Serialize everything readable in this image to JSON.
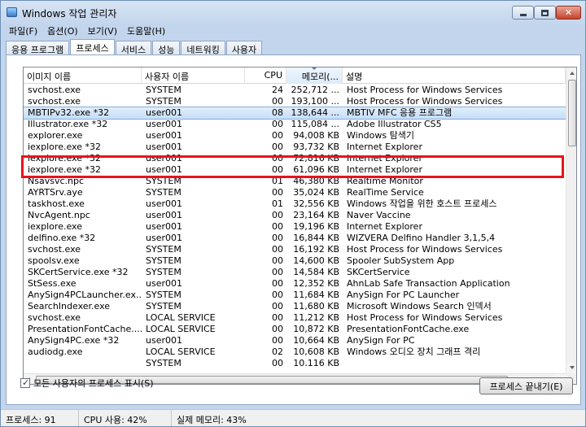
{
  "window": {
    "title": "Windows 작업 관리자"
  },
  "colors": {
    "selection_outline": "#e8141c",
    "titlebar": "#c9d9ee"
  },
  "menu": [
    "파일(F)",
    "옵션(O)",
    "보기(V)",
    "도움말(H)"
  ],
  "tabs": [
    {
      "label": "응용 프로그램",
      "active": false
    },
    {
      "label": "프로세스",
      "active": true
    },
    {
      "label": "서비스",
      "active": false
    },
    {
      "label": "성능",
      "active": false
    },
    {
      "label": "네트워킹",
      "active": false
    },
    {
      "label": "사용자",
      "active": false
    }
  ],
  "columns": {
    "name": "이미지 이름",
    "user": "사용자 이름",
    "cpu": "CPU",
    "mem": "메모리(...",
    "desc": "설명"
  },
  "rows": [
    [
      "svchost.exe",
      "SYSTEM",
      "24",
      "252,712 ...",
      "Host Process for Windows Services"
    ],
    [
      "svchost.exe",
      "SYSTEM",
      "00",
      "193,100 ...",
      "Host Process for Windows Services"
    ],
    [
      "MBTIPv32.exe *32",
      "user001",
      "08",
      "138,644 ...",
      "MBTIV MFC 응용 프로그램"
    ],
    [
      "Illustrator.exe *32",
      "user001",
      "00",
      "115,084 ...",
      "Adobe Illustrator CS5"
    ],
    [
      "explorer.exe",
      "user001",
      "00",
      "94,008 KB",
      "Windows 탐색기"
    ],
    [
      "iexplore.exe *32",
      "user001",
      "00",
      "93,732 KB",
      "Internet Explorer"
    ],
    [
      "iexplore.exe *32",
      "user001",
      "00",
      "72,816 KB",
      "Internet Explorer"
    ],
    [
      "iexplore.exe *32",
      "user001",
      "00",
      "61,096 KB",
      "Internet Explorer"
    ],
    [
      "Nsavsvc.npc",
      "SYSTEM",
      "01",
      "46,380 KB",
      "Realtime Monitor"
    ],
    [
      "AYRTSrv.aye",
      "SYSTEM",
      "00",
      "35,024 KB",
      "RealTime Service"
    ],
    [
      "taskhost.exe",
      "user001",
      "01",
      "32,556 KB",
      "Windows 작업을 위한 호스트 프로세스"
    ],
    [
      "NvcAgent.npc",
      "user001",
      "00",
      "23,164 KB",
      "Naver Vaccine"
    ],
    [
      "iexplore.exe",
      "user001",
      "00",
      "19,196 KB",
      "Internet Explorer"
    ],
    [
      "delfino.exe *32",
      "user001",
      "00",
      "16,844 KB",
      "WIZVERA Delfino Handler 3,1,5,4"
    ],
    [
      "svchost.exe",
      "SYSTEM",
      "00",
      "16,192 KB",
      "Host Process for Windows Services"
    ],
    [
      "spoolsv.exe",
      "SYSTEM",
      "00",
      "14,600 KB",
      "Spooler SubSystem App"
    ],
    [
      "SKCertService.exe *32",
      "SYSTEM",
      "00",
      "14,584 KB",
      "SKCertService"
    ],
    [
      "StSess.exe",
      "user001",
      "00",
      "12,352 KB",
      "AhnLab Safe Transaction Application"
    ],
    [
      "AnySign4PCLauncher.ex...",
      "SYSTEM",
      "00",
      "11,684 KB",
      "AnySign For PC Launcher"
    ],
    [
      "SearchIndexer.exe",
      "SYSTEM",
      "00",
      "11,680 KB",
      "Microsoft Windows Search 인덱서"
    ],
    [
      "svchost.exe",
      "LOCAL SERVICE",
      "00",
      "11,212 KB",
      "Host Process for Windows Services"
    ],
    [
      "PresentationFontCache....",
      "LOCAL SERVICE",
      "00",
      "10,872 KB",
      "PresentationFontCache.exe"
    ],
    [
      "AnySign4PC.exe *32",
      "user001",
      "00",
      "10,664 KB",
      "AnySign For PC"
    ],
    [
      "audiodg.exe",
      "LOCAL SERVICE",
      "02",
      "10,608 KB",
      "Windows 오디오 장치 그래프 격리"
    ],
    [
      "",
      "SYSTEM",
      "00",
      "10,116 KB",
      ""
    ]
  ],
  "selected_row": 2,
  "show_all_label": "모든 사용자의 프로세스 표시(S)",
  "show_all_checked": true,
  "end_process_label": "프로세스 끝내기(E)",
  "status": {
    "processes": "프로세스: 91",
    "cpu": "CPU 사용: 42%",
    "memory": "실제 메모리: 43%"
  }
}
